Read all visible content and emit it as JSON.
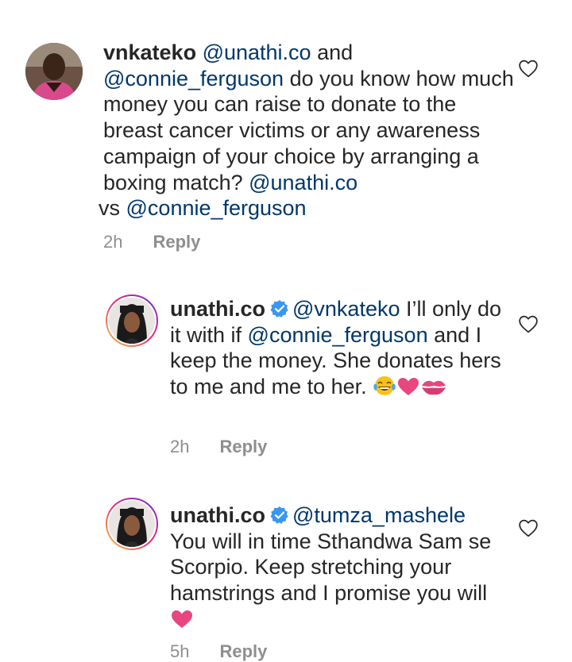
{
  "comments": [
    {
      "username": "vnkateko",
      "segments": [
        {
          "text": "@unathi.co",
          "mention": true
        },
        {
          "text": " and ",
          "mention": false
        },
        {
          "text": "@connie_ferguson",
          "mention": true
        },
        {
          "text": " do you know how much money you can raise to donate to the breast cancer victims or any awareness campaign of your choice by arranging a boxing match? ",
          "mention": false
        },
        {
          "text": "@unathi.co",
          "mention": true
        },
        {
          "text": " vs ",
          "mention": false
        },
        {
          "text": "@connie_ferguson",
          "mention": true
        }
      ],
      "time": "2h",
      "reply_label": "Reply",
      "verified": false
    },
    {
      "username": "unathi.co",
      "segments": [
        {
          "text": "@vnkateko",
          "mention": true
        },
        {
          "text": " I’ll only do it with if ",
          "mention": false
        },
        {
          "text": "@connie_ferguson",
          "mention": true
        },
        {
          "text": " and I keep the money. She donates hers to me and me to her. ",
          "mention": false
        }
      ],
      "emojis": [
        "tears-of-joy-emoji",
        "pink-heart-emoji",
        "kiss-mark-emoji"
      ],
      "time": "2h",
      "reply_label": "Reply",
      "verified": true
    },
    {
      "username": "unathi.co",
      "segments": [
        {
          "text": "@tumza_mashele",
          "mention": true
        },
        {
          "text": " You will in time Sthandwa Sam se Scorpio. Keep stretching your hamstrings and I promise you will",
          "mention": false
        }
      ],
      "emojis": [
        "pink-heart-emoji"
      ],
      "time": "5h",
      "reply_label": "Reply",
      "verified": true
    }
  ],
  "colors": {
    "text": "#262626",
    "mention": "#00376b",
    "meta": "#8e8e8e",
    "verified": "#3897f0",
    "heart_emoji": "#e7467f"
  }
}
